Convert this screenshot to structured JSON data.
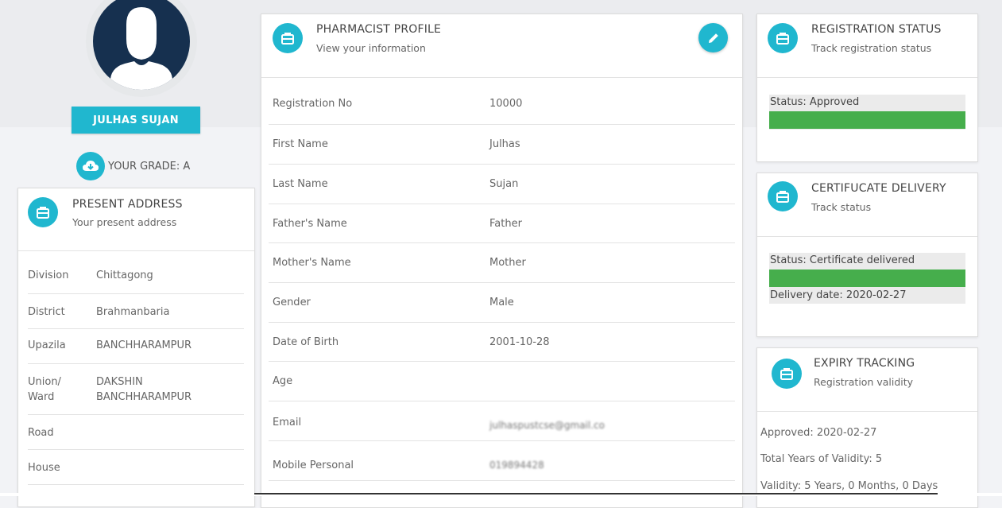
{
  "profile": {
    "name": "JULHAS SUJAN",
    "grade_text": "YOUR GRADE: A"
  },
  "present_address": {
    "title": "PRESENT ADDRESS",
    "subtitle": "Your present address",
    "rows": [
      {
        "label": "Division",
        "value": "Chittagong"
      },
      {
        "label": "District",
        "value": "Brahmanbaria"
      },
      {
        "label": "Upazila",
        "value": "BANCHHARAMPUR"
      },
      {
        "label": "Union/ Ward",
        "value": "DAKSHIN BANCHHARAMPUR"
      },
      {
        "label": "Road",
        "value": ""
      },
      {
        "label": "House",
        "value": ""
      }
    ]
  },
  "pharmacist_profile": {
    "title": "PHARMACIST PROFILE",
    "subtitle": "View your information",
    "edit_icon": "pencil-icon",
    "rows": [
      {
        "label": "Registration No",
        "value": "10000"
      },
      {
        "label": "First Name",
        "value": "Julhas"
      },
      {
        "label": "Last Name",
        "value": "Sujan"
      },
      {
        "label": "Father's Name",
        "value": "Father"
      },
      {
        "label": "Mother's Name",
        "value": "Mother"
      },
      {
        "label": "Gender",
        "value": "Male"
      },
      {
        "label": "Date of Birth",
        "value": "2001-10-28"
      },
      {
        "label": "Age",
        "value": ""
      },
      {
        "label": "Email",
        "value": "julhaspustcse@gmail.co"
      },
      {
        "label": "Mobile Personal",
        "value": "019894428"
      }
    ]
  },
  "registration_status": {
    "title": "REGISTRATION STATUS",
    "subtitle": "Track registration status",
    "status": "Status: Approved",
    "progress": 1.0
  },
  "certificate_delivery": {
    "title": "CERTIFUCATE DELIVERY",
    "subtitle": "Track status",
    "status": "Status: Certificate delivered",
    "progress": 1.0,
    "delivery_date": "Delivery date: 2020-02-27"
  },
  "expiry_tracking": {
    "title": "EXPIRY TRACKING",
    "subtitle": "Registration validity",
    "approved": "Approved: 2020-02-27",
    "total_years": "Total Years of Validity: 5",
    "validity": "Validity: 5 Years, 0 Months, 0 Days"
  },
  "colors": {
    "accent": "#20b7cf",
    "progress": "#46ae4c",
    "avatar_bg": "#16304f"
  }
}
